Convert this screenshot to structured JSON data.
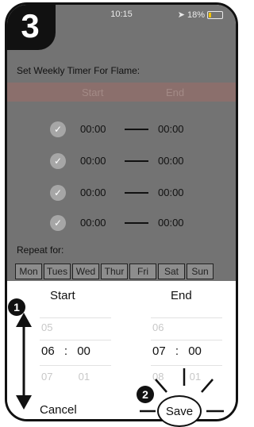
{
  "step_badge": "3",
  "status_bar": {
    "time": "10:15",
    "signal": "✶",
    "location": "➤",
    "battery": "18%"
  },
  "timer": {
    "title": "Set Weekly Timer For Flame:",
    "column_start": "Start",
    "column_end": "End",
    "rows": [
      {
        "start": "00:00",
        "end": "00:00"
      },
      {
        "start": "00:00",
        "end": "00:00"
      },
      {
        "start": "00:00",
        "end": "00:00"
      },
      {
        "start": "00:00",
        "end": "00:00"
      }
    ],
    "check_glyph": "✓"
  },
  "repeat": {
    "label": "Repeat for:",
    "days": [
      "Mon",
      "Tues",
      "Wed",
      "Thur",
      "Fri",
      "Sat",
      "Sun"
    ]
  },
  "picker": {
    "start_title": "Start",
    "end_title": "End",
    "start_hour_above": "05",
    "start_hour": "06",
    "start_hour_below": "07",
    "start_minute": "00",
    "start_minute_below": "01",
    "end_hour_above": "06",
    "end_hour": "07",
    "end_hour_below": "08",
    "end_minute": "00",
    "end_minute_below": "01",
    "separator": ":"
  },
  "actions": {
    "cancel": "Cancel",
    "save": "Save"
  },
  "annotations": {
    "marker_1": "1",
    "marker_2": "2"
  }
}
